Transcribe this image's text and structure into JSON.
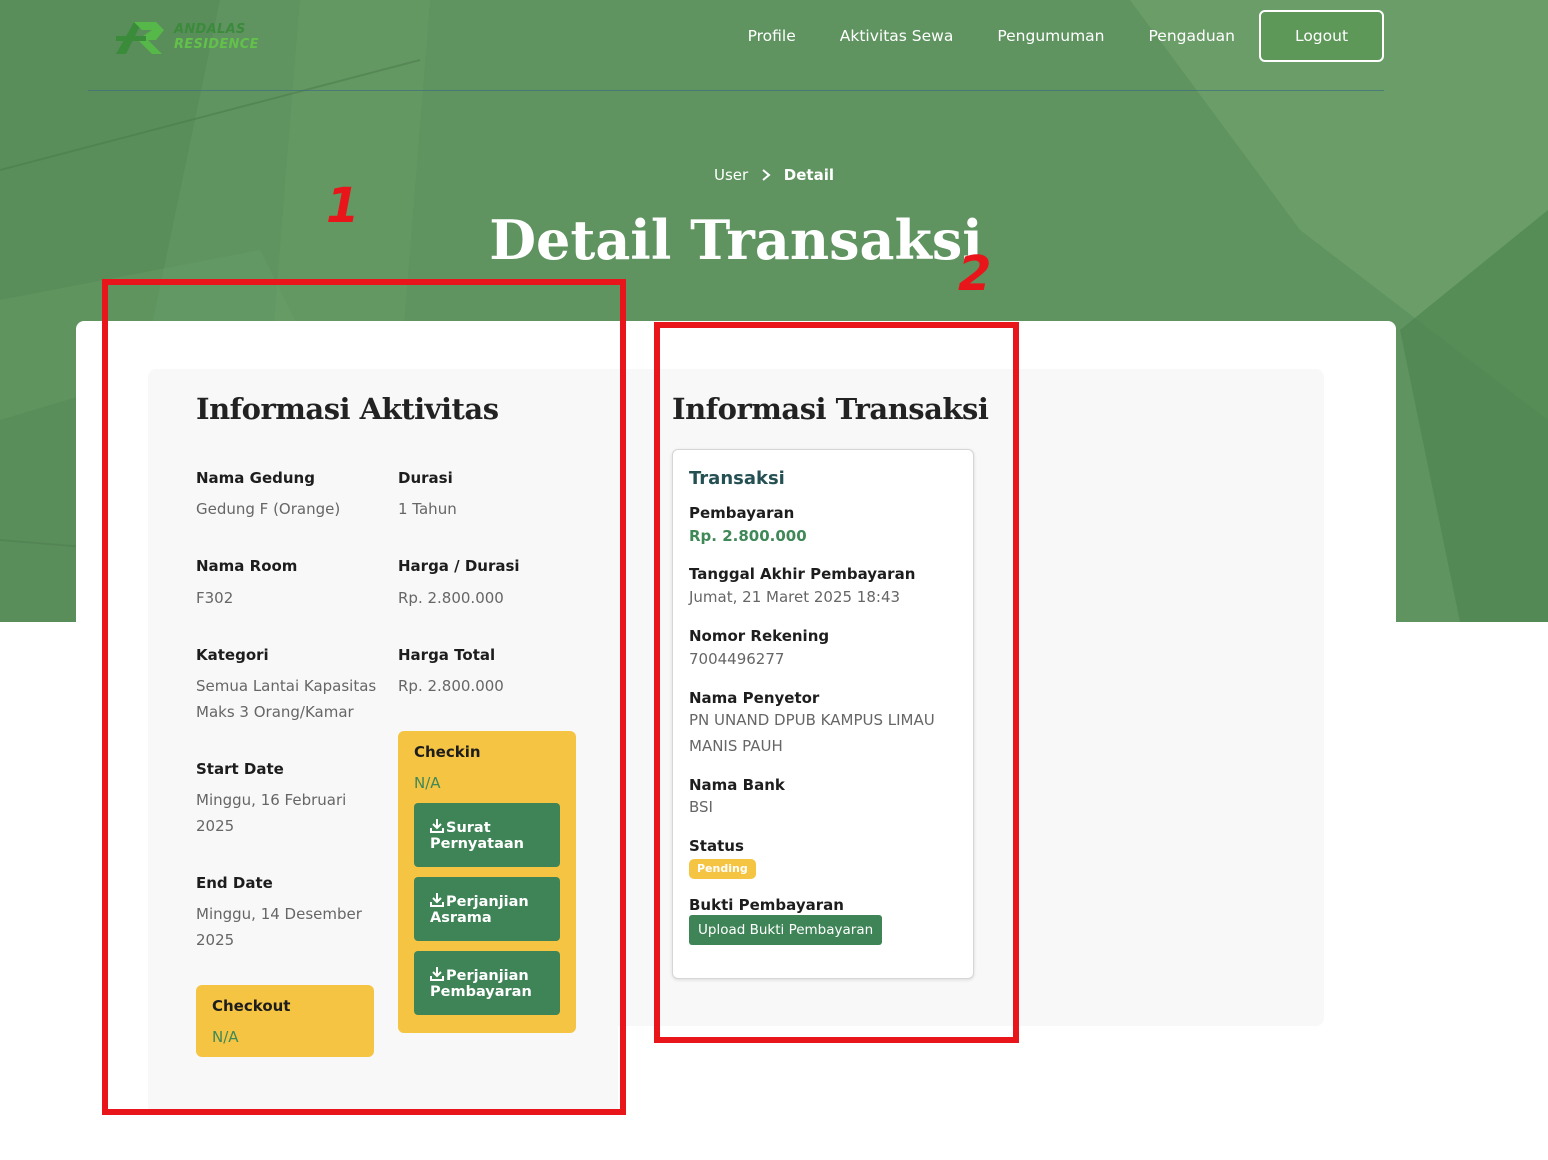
{
  "brand": {
    "line1": "ANDALAS",
    "line2": "RESIDENCE"
  },
  "nav": {
    "items": [
      "Profile",
      "Aktivitas Sewa",
      "Pengumuman",
      "Pengaduan"
    ],
    "logout": "Logout"
  },
  "breadcrumb": {
    "parent": "User",
    "current": "Detail"
  },
  "page_title": "Detail Transaksi",
  "aktivitas": {
    "title": "Informasi Aktivitas",
    "nama_gedung_label": "Nama Gedung",
    "nama_gedung_value": "Gedung F (Orange)",
    "durasi_label": "Durasi",
    "durasi_value": "1 Tahun",
    "nama_room_label": "Nama Room",
    "nama_room_value": "F302",
    "harga_durasi_label": "Harga / Durasi",
    "harga_durasi_value": "Rp. 2.800.000",
    "kategori_label": "Kategori",
    "kategori_value_line1": "Semua Lantai Kapasitas",
    "kategori_value_line2": "Maks 3 Orang/Kamar",
    "harga_total_label": "Harga Total",
    "harga_total_value": "Rp. 2.800.000",
    "start_date_label": "Start Date",
    "start_date_line1": "Minggu, 16 Februari",
    "start_date_line2": "2025",
    "end_date_label": "End Date",
    "end_date_line1": "Minggu, 14 Desember",
    "end_date_line2": "2025",
    "checkout_label": "Checkout",
    "checkout_value": "N/A",
    "checkin_label": "Checkin",
    "checkin_value": "N/A",
    "btn_surat": {
      "line1": "Surat",
      "line2": "Pernyataan"
    },
    "btn_asrama": {
      "line1": "Perjanjian",
      "line2": "Asrama"
    },
    "btn_pembayaran": {
      "line1": "Perjanjian",
      "line2": "Pembayaran"
    }
  },
  "transaksi": {
    "section_title": "Informasi Transaksi",
    "card_title": "Transaksi",
    "pembayaran_label": "Pembayaran",
    "pembayaran_value": "Rp. 2.800.000",
    "tanggal_label": "Tanggal Akhir Pembayaran",
    "tanggal_value": "Jumat, 21 Maret 2025 18:43",
    "rekening_label": "Nomor Rekening",
    "rekening_value": "7004496277",
    "penyetor_label": "Nama Penyetor",
    "penyetor_line1": "PN UNAND DPUB KAMPUS LIMAU",
    "penyetor_line2": "MANIS PAUH",
    "bank_label": "Nama Bank",
    "bank_value": "BSI",
    "status_label": "Status",
    "status_value": "Pending",
    "bukti_label": "Bukti Pembayaran",
    "upload_button": "Upload Bukti Pembayaran"
  },
  "annotations": {
    "one": "1",
    "two": "2",
    "color": "#e8161b"
  },
  "colors": {
    "hero_green": "#5f9460",
    "button_green": "#3f8457",
    "yellow": "#f5c443"
  },
  "icons": [
    "logo-icon",
    "chevron-right-icon",
    "download-icon"
  ]
}
